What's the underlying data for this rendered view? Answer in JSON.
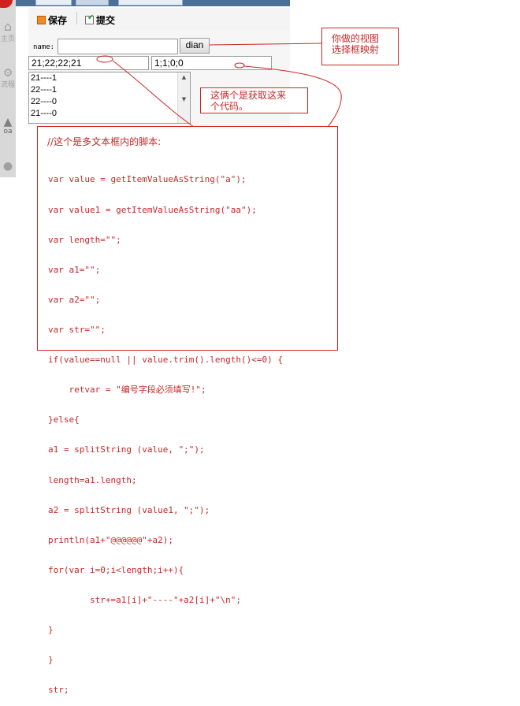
{
  "toolbar": {
    "save_label": "保存",
    "submit_label": "提交"
  },
  "form": {
    "name_label": "name:",
    "name_value": "",
    "dian_button": "dian",
    "field_a_value": "21;22;22;21",
    "field_aa_value": "1;1;0;0",
    "textarea_lines": [
      "21----1",
      "22----1",
      "22----0",
      "21----0"
    ]
  },
  "sidebar": {
    "items": [
      "主页",
      "流程",
      "oa",
      ""
    ]
  },
  "annotations": {
    "view_mapping_note": [
      "你做的视图",
      "选择框映射"
    ],
    "source_note": [
      "这俩个是获取这来",
      "个代码。"
    ],
    "script_comment": "//这个是多文本框内的脚本:"
  },
  "script_lines": [
    "var value = getItemValueAsString(\"a\");",
    "var value1 = getItemValueAsString(\"aa\");",
    "var length=\"\";",
    "var a1=\"\";",
    "var a2=\"\";",
    "var str=\"\";",
    "if(value==null || value.trim().length()<=0) {",
    "    retvar = \"编号字段必须填写!\";",
    "}else{",
    "a1 = splitString (value, \";\");",
    "length=a1.length;",
    "a2 = splitString (value1, \";\");",
    "println(a1+\"@@@@@@\"+a2);",
    "for(var i=0;i<length;i++){",
    "        str+=a1[i]+\"----\"+a2[i]+\"\\n\";",
    "}",
    "}",
    "str;"
  ],
  "colors": {
    "annotation_red": "#c62828",
    "tab_blue": "#4c6f98"
  }
}
